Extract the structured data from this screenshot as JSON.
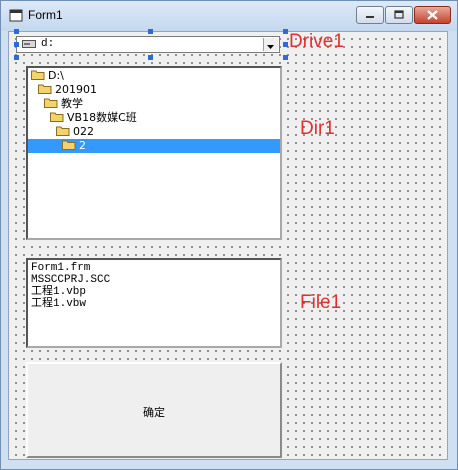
{
  "window": {
    "title": "Form1"
  },
  "drive": {
    "value": "d:"
  },
  "dirlist": {
    "items": [
      {
        "label": "D:\\"
      },
      {
        "label": "201901"
      },
      {
        "label": "教学"
      },
      {
        "label": "VB18数媒C班"
      },
      {
        "label": "022"
      },
      {
        "label": "2",
        "selected": true
      }
    ]
  },
  "filelist": {
    "items": [
      "Form1.frm",
      "MSSCCPRJ.SCC",
      "工程1.vbp",
      "工程1.vbw"
    ]
  },
  "button": {
    "ok_label": "确定"
  },
  "labels": {
    "drive": "Drive1",
    "dir": "Dir1",
    "file": "File1"
  },
  "colors": {
    "selection": "#3399ff",
    "annotation": "#e03030"
  }
}
